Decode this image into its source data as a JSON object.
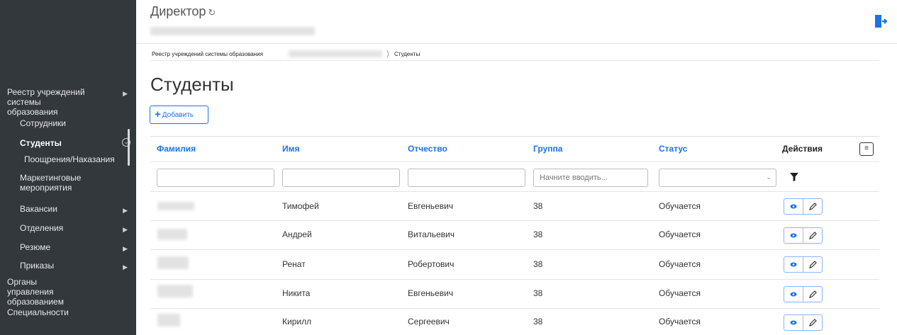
{
  "header": {
    "title": "Директор",
    "refresh_icon": "↻"
  },
  "sidebar": {
    "items": [
      {
        "label": "Реестр учреждений системы образования",
        "arrow": "▶"
      },
      {
        "label": "Сотрудники"
      },
      {
        "label": "Студенты",
        "expand": "⌄"
      },
      {
        "label": "Поощрения/Наказания"
      },
      {
        "label": "Маркетинговые мероприятия"
      },
      {
        "label": "Вакансии",
        "arrow": "▶"
      },
      {
        "label": "Отделения",
        "arrow": "▶"
      },
      {
        "label": "Резюме",
        "arrow": "▶"
      },
      {
        "label": "Приказы",
        "arrow": "▶"
      },
      {
        "label": "Органы управления образованием"
      },
      {
        "label": "Специальности"
      }
    ]
  },
  "breadcrumb": {
    "root": "Реестр учреждений системы образования",
    "current": "Студенты",
    "sep": ")"
  },
  "page": {
    "title": "Студенты",
    "add_label": "Добавить",
    "add_icon": "+"
  },
  "table": {
    "columns": [
      "Фамилия",
      "Имя",
      "Отчество",
      "Группа",
      "Статус",
      "Действия"
    ],
    "settings_icon": "≡",
    "filters": {
      "group_placeholder": "Начните вводить..."
    },
    "rows": [
      {
        "name": "Тимофей",
        "patronymic": "Евгеньевич",
        "group": "38",
        "status": "Обучается"
      },
      {
        "name": "Андрей",
        "patronymic": "Витальевич",
        "group": "38",
        "status": "Обучается"
      },
      {
        "name": "Ренат",
        "patronymic": "Робертович",
        "group": "38",
        "status": "Обучается"
      },
      {
        "name": "Никита",
        "patronymic": "Евгеньевич",
        "group": "38",
        "status": "Обучается"
      },
      {
        "name": "Кирилл",
        "patronymic": "Сергеевич",
        "group": "38",
        "status": "Обучается"
      }
    ]
  },
  "colors": {
    "accent": "#1a73e8",
    "sidebar_bg": "#33383d"
  }
}
